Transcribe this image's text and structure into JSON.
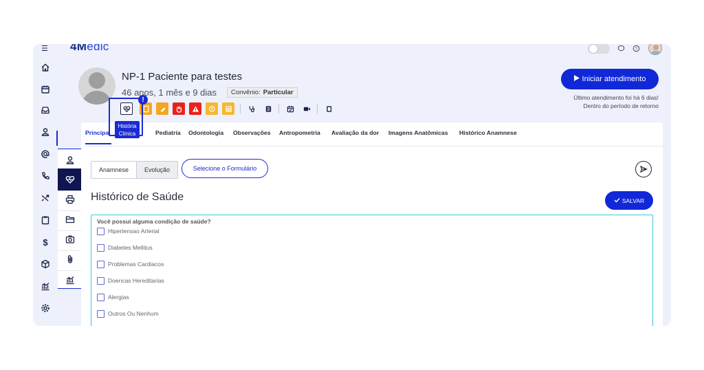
{
  "app": {
    "logo_bold": "4M",
    "logo_rest": "edic"
  },
  "topbar": {
    "menu_icon": "hamburger-icon",
    "icons": [
      "chat-icon",
      "help-icon"
    ]
  },
  "sidebar": {
    "items": [
      {
        "icon": "home-icon"
      },
      {
        "icon": "calendar-icon"
      },
      {
        "icon": "inbox-icon"
      },
      {
        "icon": "user-icon"
      },
      {
        "icon": "at-icon"
      },
      {
        "icon": "phone-icon"
      },
      {
        "icon": "shuffle-icon"
      },
      {
        "icon": "clipboard-icon"
      },
      {
        "icon": "dollar-icon"
      },
      {
        "icon": "box-icon"
      },
      {
        "icon": "chart-icon"
      },
      {
        "icon": "gear-icon"
      }
    ]
  },
  "subsidebar": {
    "items": [
      {
        "icon": "user-icon"
      },
      {
        "icon": "heart-pulse-icon"
      },
      {
        "icon": "printer-icon"
      },
      {
        "icon": "folder-icon"
      },
      {
        "icon": "camera-icon"
      },
      {
        "icon": "paperclip-icon"
      },
      {
        "icon": "chart-icon"
      }
    ]
  },
  "patient": {
    "name": "NP-1 Paciente para testes",
    "age": "46 anos, 1 mês e 9 dias",
    "convenio_label": "Convênio:",
    "convenio_value": "Particular"
  },
  "actions": {
    "start_button": "Iniciar atendimento",
    "note_line1": "Último atendimento foi há 6 dias!",
    "note_line2": "Dentro do período de retorno",
    "tooltip_line1": "História",
    "tooltip_line2": "Clínica",
    "alert_badge": "!",
    "colors": {
      "orange": "#f5a623",
      "red": "#e8231b",
      "yellow": "#f5b82e"
    }
  },
  "tabs": [
    "Principal",
    "Pediatria",
    "Odontologia",
    "Observações",
    "Antropometria",
    "Avaliação da dor",
    "Imagens Anatômicas",
    "Histórico Anamnese"
  ],
  "form": {
    "seg_anamnese": "Anamnese",
    "seg_evolucao": "Evolução",
    "select_form": "Selecione o Formulário",
    "section_title": "Histórico de Saúde",
    "save_label": "SALVAR",
    "question": "Você possui alguma condição de saúde?",
    "options": [
      "Hipertensao Arterial",
      "Diabetes Mellitus",
      "Problemas Cardiacos",
      "Doencas Hereditarias",
      "Alergias",
      "Outros Ou Nenhum"
    ]
  }
}
